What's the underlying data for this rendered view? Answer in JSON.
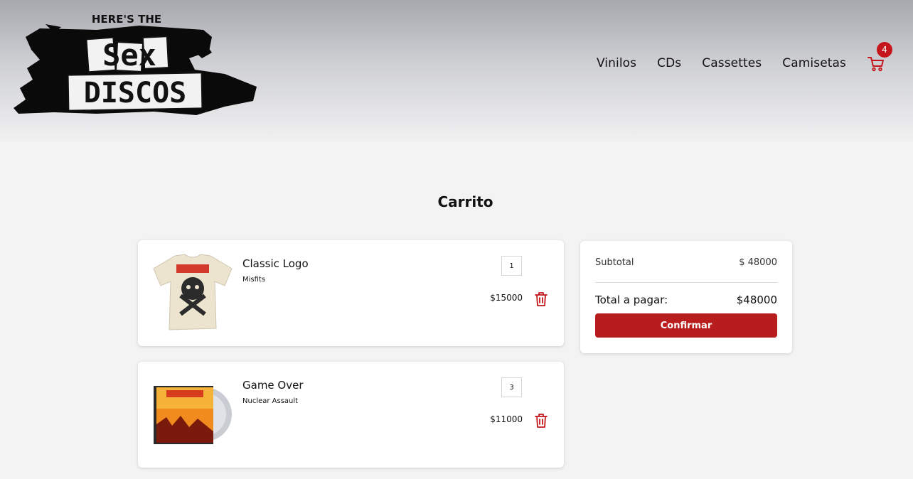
{
  "brand": {
    "logo_line1": "HERE'S THE",
    "logo_line2": "Sex",
    "logo_line3": "DISCOS"
  },
  "nav": {
    "items": [
      {
        "label": "Vinilos"
      },
      {
        "label": "CDs"
      },
      {
        "label": "Cassettes"
      },
      {
        "label": "Camisetas"
      }
    ],
    "cart_icon": "shopping-cart-icon",
    "cart_count": "4"
  },
  "page": {
    "title": "Carrito"
  },
  "cart": {
    "items": [
      {
        "name": "Classic Logo",
        "artist": "Misfits",
        "quantity": "1",
        "price": "$15000",
        "image": "t-shirt-image"
      },
      {
        "name": "Game Over",
        "artist": "Nuclear Assault",
        "quantity": "3",
        "price": "$11000",
        "image": "cd-album-image"
      }
    ],
    "delete_icon": "trash-icon"
  },
  "summary": {
    "subtotal_label": "Subtotal",
    "subtotal_value": "$ 48000",
    "total_label": "Total a pagar:",
    "total_value": "$48000",
    "confirm_label": "Confirmar"
  },
  "colors": {
    "accent": "#b81c1c",
    "badge": "#c4161c",
    "background": "#f3f3f3",
    "text": "#111111"
  }
}
